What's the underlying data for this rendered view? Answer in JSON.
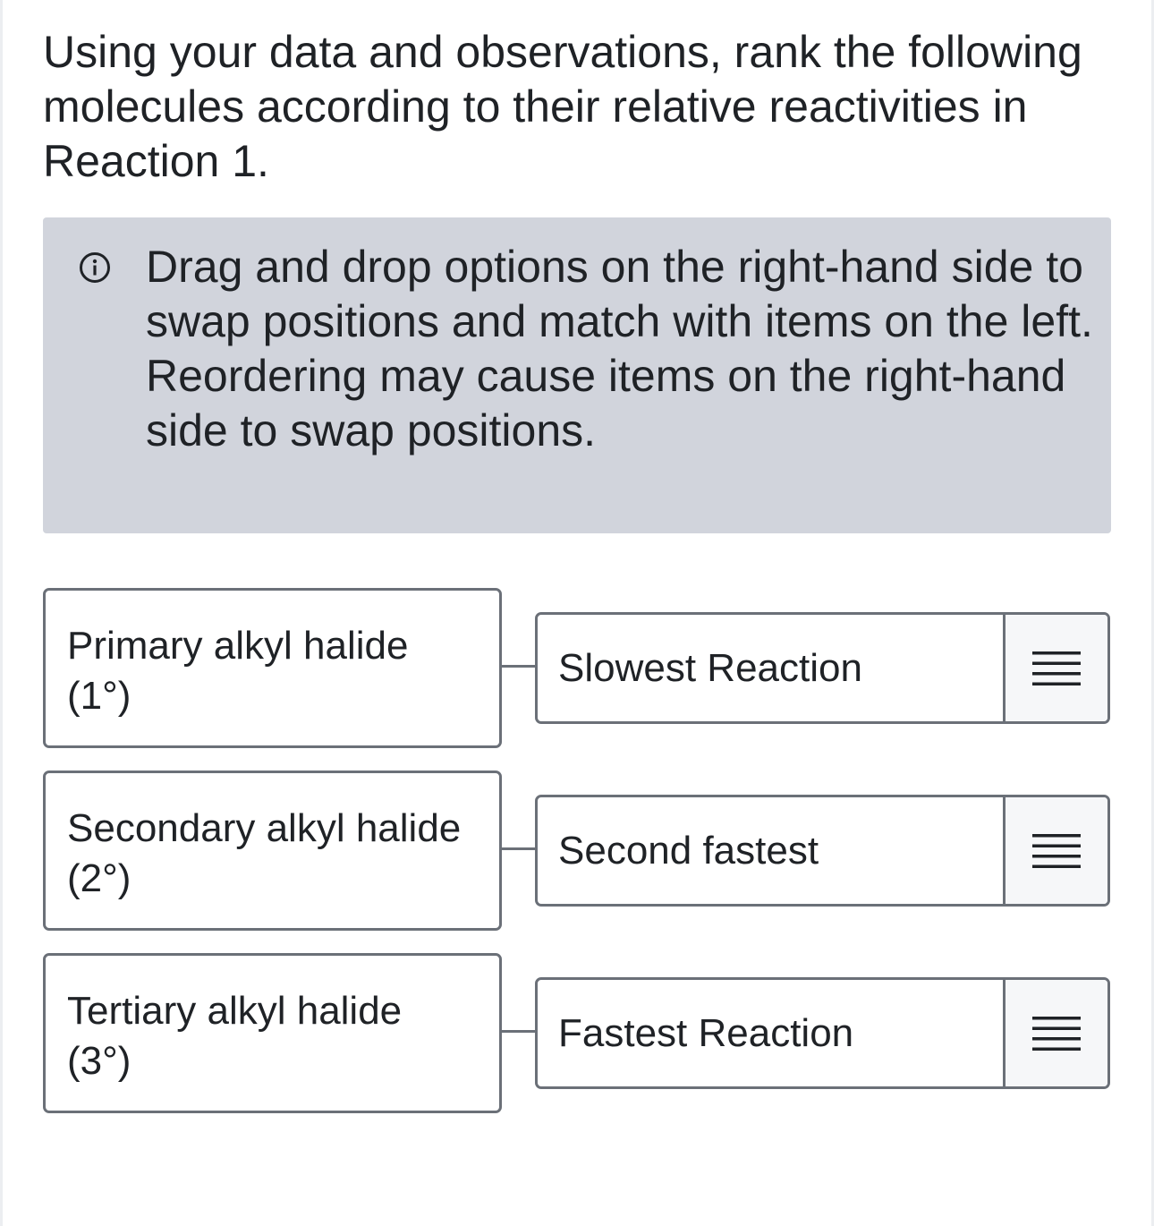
{
  "question": "Using your data and observations, rank the following molecules according to their relative reactivities in Reaction 1.",
  "info": {
    "icon": "info-circle-icon",
    "line1": "Drag and drop options on the right-hand side to swap positions and match with items on the left.",
    "line2": "Reordering may cause items on the right-hand side to swap positions."
  },
  "left_items": [
    {
      "line1": "Primary alkyl halide",
      "line2": "(1°)"
    },
    {
      "line1": "Secondary alkyl halide",
      "line2": "(2°)"
    },
    {
      "line1": "Tertiary alkyl halide",
      "line2": "(3°)"
    }
  ],
  "right_items": [
    {
      "label": "Slowest Reaction",
      "handle_icon": "drag-handle-icon"
    },
    {
      "label": "Second fastest",
      "handle_icon": "drag-handle-icon"
    },
    {
      "label": "Fastest Reaction",
      "handle_icon": "drag-handle-icon"
    }
  ],
  "colors": {
    "info_background": "#d1d4dc",
    "border": "#6b7078",
    "text": "#1f2226"
  }
}
